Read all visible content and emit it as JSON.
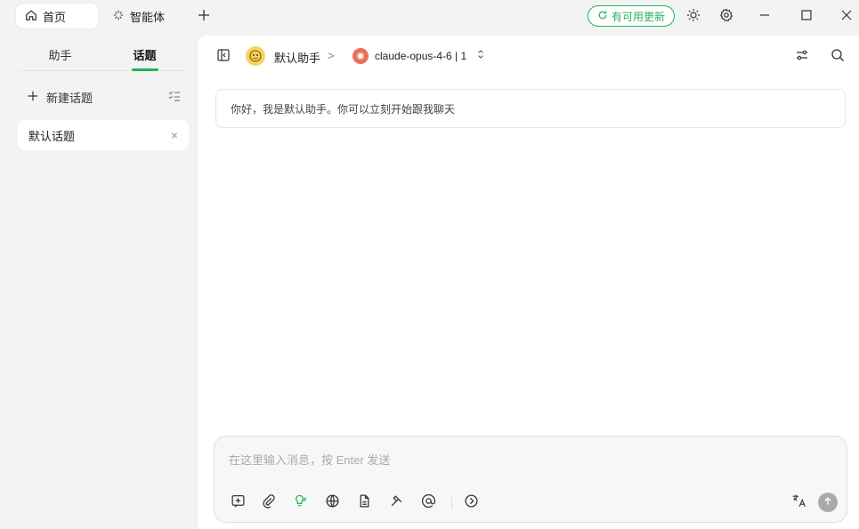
{
  "titlebar": {
    "tabs": [
      {
        "label": "首页",
        "icon": "home-icon",
        "active": true
      },
      {
        "label": "智能体",
        "icon": "sparkle-icon",
        "active": false
      }
    ],
    "add_tab_icon": "plus-icon",
    "update_badge": "有可用更新",
    "theme_icon": "sun-icon",
    "settings_icon": "gear-icon",
    "window_controls": [
      "minimize-icon",
      "maximize-icon",
      "close-icon"
    ]
  },
  "sidebar": {
    "tabs": [
      {
        "label": "助手",
        "active": false
      },
      {
        "label": "话题",
        "active": true
      }
    ],
    "new_topic_label": "新建话题",
    "topics": [
      {
        "label": "默认话题"
      }
    ]
  },
  "header": {
    "assistant_name": "默认助手",
    "separator": ">",
    "model_name": "claude-opus-4-6 | 1",
    "chevron": "⌃⌄"
  },
  "chat": {
    "welcome_message": "你好，我是默认助手。你可以立刻开始跟我聊天"
  },
  "composer": {
    "placeholder": "在这里输入消息，按 Enter 发送",
    "tools": [
      "new-topic-icon",
      "attachment-icon",
      "thinking-icon",
      "web-search-icon",
      "knowledge-icon",
      "mcp-tools-icon",
      "mention-icon",
      "expand-icon"
    ],
    "translate_icon": "translate-icon",
    "send_icon": "send-icon"
  },
  "colors": {
    "accent": "#21b35a",
    "background": "#f3f3f3",
    "panel": "#ffffff"
  }
}
